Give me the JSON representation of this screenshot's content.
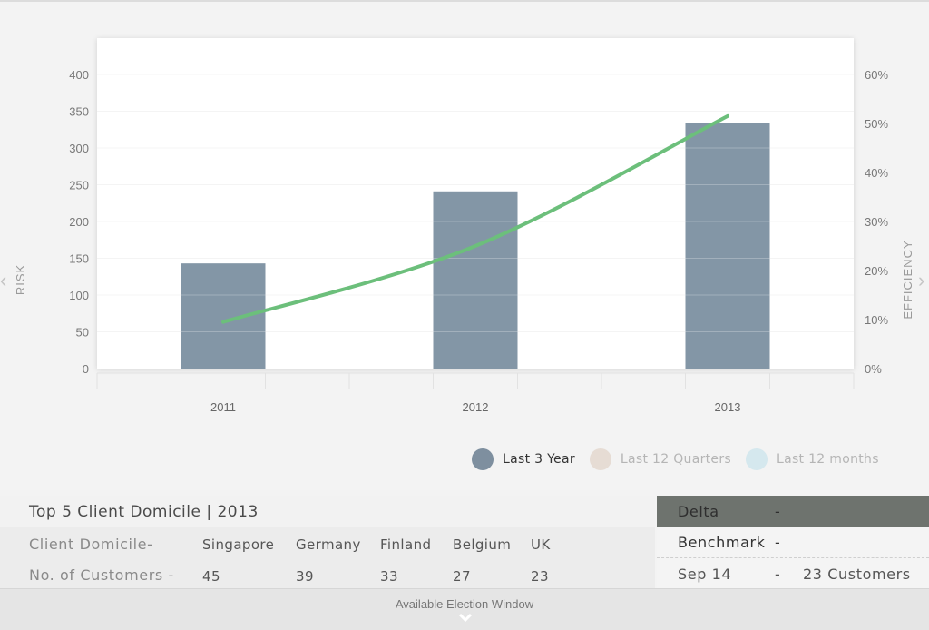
{
  "chart_data": {
    "type": "bar",
    "categories": [
      "2011",
      "2012",
      "2013"
    ],
    "series": [
      {
        "values": [
          143,
          241,
          334
        ],
        "axis": "left",
        "color": "#8396a6"
      },
      {
        "values": [
          9.5,
          25,
          51.5
        ],
        "axis": "right",
        "type": "line",
        "color": "#6cbf7b"
      }
    ],
    "ylabel": "RISK",
    "ylim": [
      0,
      400
    ],
    "yticks": [
      "0",
      "50",
      "100",
      "150",
      "200",
      "250",
      "300",
      "350",
      "400"
    ],
    "y2label": "EFFICIENCY",
    "y2lim": [
      0,
      60
    ],
    "y2ticks": [
      "0%",
      "10%",
      "20%",
      "30%",
      "40%",
      "50%",
      "60%"
    ],
    "grid": true
  },
  "nav": {
    "left": "‹",
    "right": "›"
  },
  "legend": [
    {
      "label": "Last 3 Year",
      "color": "#7e8f9f",
      "active": true
    },
    {
      "label": "Last 12 Quarters",
      "color": "#e6dcd4",
      "active": false
    },
    {
      "label": "Last 12 months",
      "color": "#d5e8ee",
      "active": false
    }
  ],
  "top5": {
    "title": "Top 5 Client Domicile | 2013",
    "row1_label": "Client Domicile-",
    "row2_label": "No. of Customers -",
    "countries": [
      "Singapore",
      "Germany",
      "Finland",
      "Belgium",
      "UK"
    ],
    "customers": [
      "45",
      "39",
      "33",
      "27",
      "23"
    ]
  },
  "delta": {
    "rows": [
      {
        "key": "Delta",
        "dash": "-",
        "value": ""
      },
      {
        "key": "Benchmark",
        "dash": "-",
        "value": ""
      },
      {
        "key": "Sep 14",
        "dash": "-",
        "value": "23 Customers"
      }
    ]
  },
  "footer": {
    "label": "Available Election Window"
  }
}
